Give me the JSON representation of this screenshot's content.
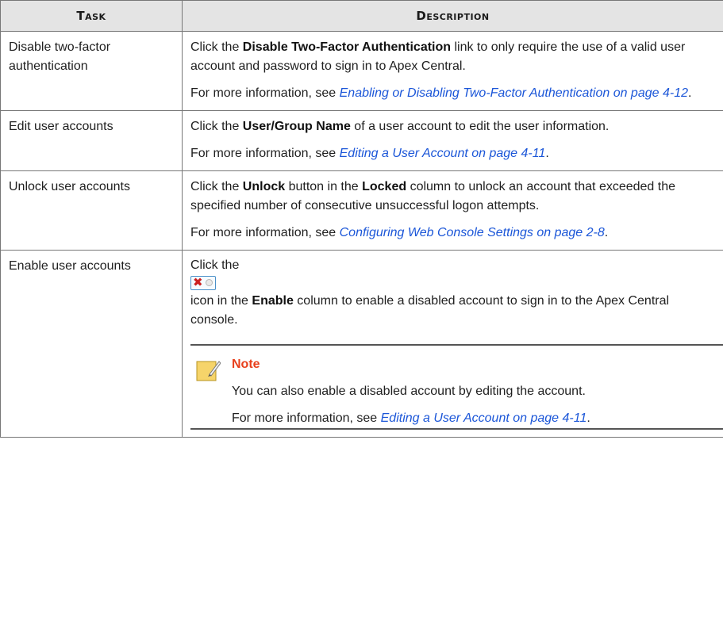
{
  "header": {
    "task": "Task",
    "description": "Description"
  },
  "rows": [
    {
      "task": "Disable two-factor authentication",
      "p1": {
        "pre": "Click the ",
        "bold1": "Disable Two-Factor Authentication",
        "post": " link to only require the use of a valid user account and password to sign in to Apex Central."
      },
      "p2": {
        "pre": "For more information, see ",
        "link": "Enabling or Disabling Two-Factor Authentication on page 4-12",
        "post": "."
      }
    },
    {
      "task": "Edit user accounts",
      "p1": {
        "pre": "Click the ",
        "bold1": "User/Group Name",
        "post": " of a user account to edit the user information."
      },
      "p2": {
        "pre": "For more information, see ",
        "link": "Editing a User Account on page 4-11",
        "post": "."
      }
    },
    {
      "task": "Unlock user accounts",
      "p1": {
        "pre": "Click the ",
        "bold1": "Unlock",
        "mid": " button in the ",
        "bold2": "Locked",
        "post": " column to unlock an account that exceeded the specified number of consecutive unsuccessful logon attempts."
      },
      "p2": {
        "pre": "For more information, see ",
        "link": "Configuring Web Console Settings on page 2-8",
        "post": "."
      }
    },
    {
      "task": "Enable user accounts",
      "p1": {
        "pre": "Click the",
        "icon": "disabled-account-icon",
        "post1": "icon in the ",
        "bold1": "Enable",
        "post2": " column to enable a disabled account to sign in to the Apex Central console."
      },
      "note": {
        "icon": "note-pencil-icon",
        "title": "Note",
        "line1": "You can also enable a disabled account by editing the account.",
        "p2": {
          "pre": "For more information, see ",
          "link": "Editing a User Account on page 4-11",
          "post": "."
        }
      }
    }
  ]
}
